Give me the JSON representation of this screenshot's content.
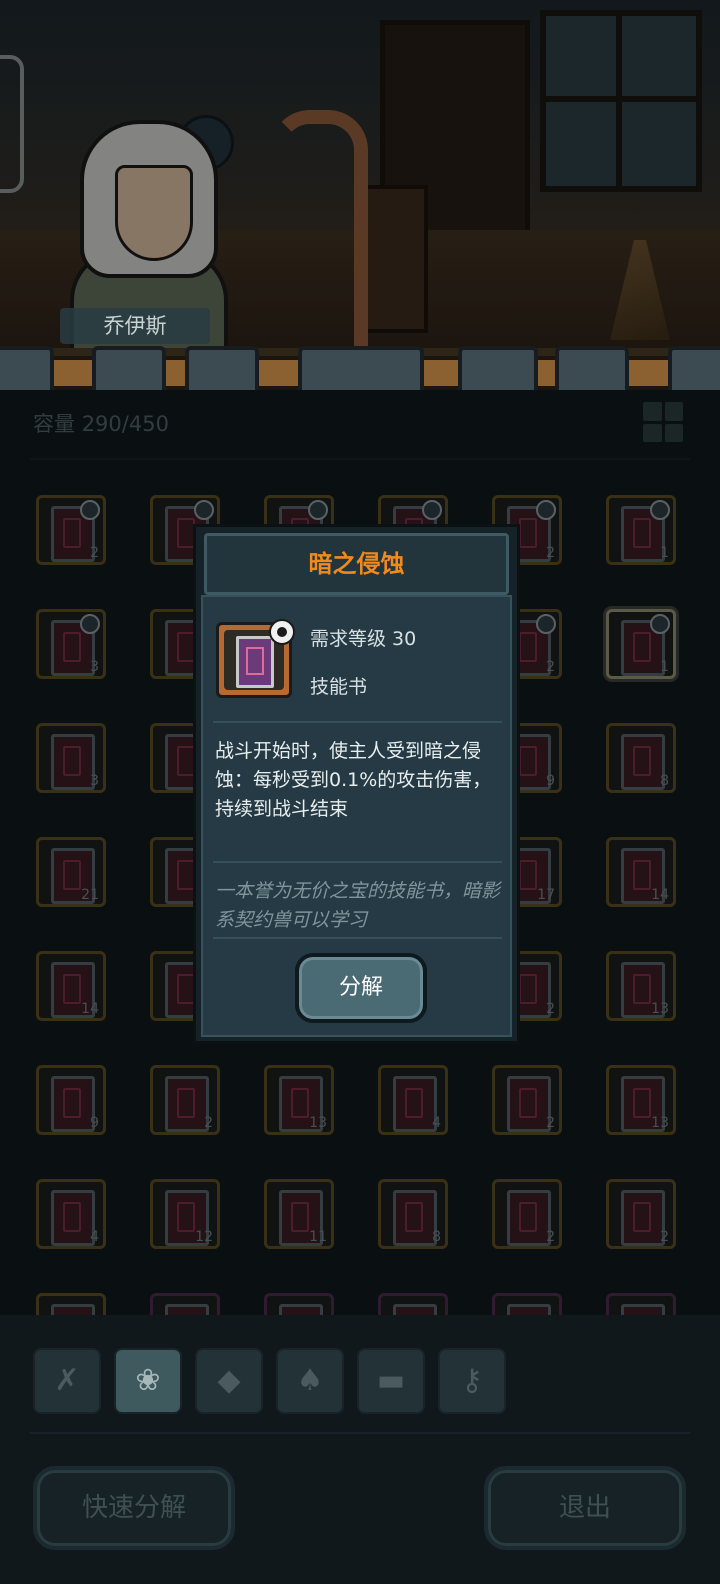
{
  "character": {
    "name": "乔伊斯"
  },
  "inventory": {
    "capacity_label": "容量",
    "capacity_value": "290/450",
    "rows": [
      [
        "2",
        "",
        "",
        "",
        "2",
        "1"
      ],
      [
        "3",
        "",
        "",
        "",
        "2",
        "1"
      ],
      [
        "3",
        "",
        "",
        "",
        "9",
        "8"
      ],
      [
        "21",
        "",
        "",
        "",
        "17",
        "14"
      ],
      [
        "14",
        "",
        "",
        "",
        "2",
        "13"
      ],
      [
        "9",
        "2",
        "13",
        "4",
        "2",
        "13"
      ],
      [
        "4",
        "12",
        "11",
        "8",
        "2",
        "2"
      ],
      [
        "",
        "",
        "",
        "",
        "",
        ""
      ]
    ]
  },
  "categories": [
    {
      "icon": "tools-icon",
      "glyph": "✗"
    },
    {
      "icon": "paw-icon",
      "glyph": "❀"
    },
    {
      "icon": "gem-icon",
      "glyph": "◆"
    },
    {
      "icon": "leaf-icon",
      "glyph": "♠"
    },
    {
      "icon": "chest-icon",
      "glyph": "▬"
    },
    {
      "icon": "key-icon",
      "glyph": "⚷"
    }
  ],
  "buttons": {
    "quick_decompose": "快速分解",
    "exit": "退出"
  },
  "item_popup": {
    "title": "暗之侵蚀",
    "requirement": "需求等级 30",
    "type": "技能书",
    "description": "战斗开始时，使主人受到暗之侵蚀：每秒受到0.1%的攻击伤害，持续到战斗结束",
    "flavor": "一本誉为无价之宝的技能书，暗影系契约兽可以学习",
    "action": "分解"
  },
  "colors": {
    "title": "#f08a1c",
    "slot_border": "#5a4a22",
    "button": "#4a6a74"
  }
}
